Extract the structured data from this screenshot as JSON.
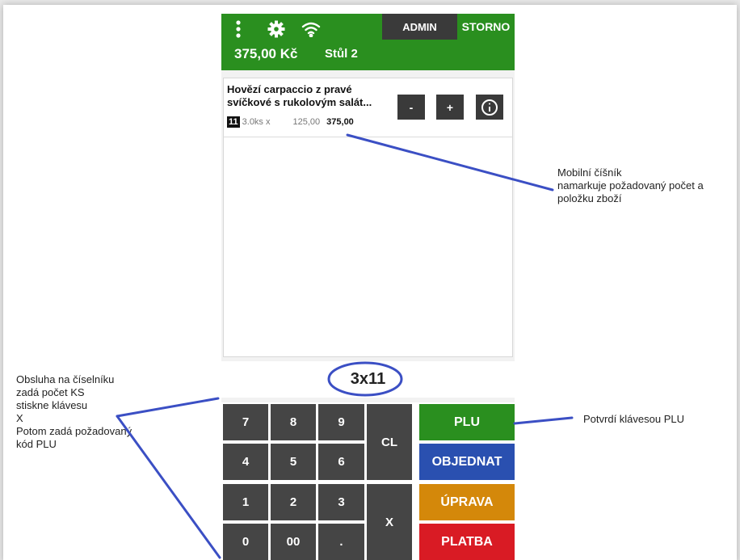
{
  "header": {
    "admin_label": "ADMIN",
    "storno_label": "STORNO",
    "total": "375,00 Kč",
    "table": "Stůl 2",
    "icons": [
      "more-vert-icon",
      "gear-icon",
      "wifi-icon"
    ]
  },
  "order": {
    "items": [
      {
        "name": "Hovězí carpaccio z pravé svíčkové s rukolovým salát...",
        "code": "11",
        "quantity": "3.0ks x",
        "unit_price": "125,00",
        "total": "375,00",
        "minus_label": "-",
        "plus_label": "+"
      }
    ]
  },
  "display": {
    "text": "3x11"
  },
  "keypad": {
    "digits": [
      "7",
      "8",
      "9",
      "4",
      "5",
      "6",
      "1",
      "2",
      "3",
      "0",
      "00",
      "."
    ],
    "clear_label": "CL",
    "multiply_label": "X",
    "plu_label": "PLU",
    "objednat_label": "OBJEDNAT",
    "uprava_label": "ÚPRAVA",
    "platba_label": "PLATBA"
  },
  "annotations": {
    "right_top": [
      "Mobilní číšník",
      "namarkuje požadovaný počet a",
      "položku zboží"
    ],
    "left": [
      "Obsluha na číselníku",
      "zadá počet KS",
      "stiskne klávesu",
      "X",
      "Potom zadá požadovaný",
      "kód PLU"
    ],
    "right_bottom": "Potvrdí klávesou PLU"
  },
  "colors": {
    "header_green": "#2a8f1f",
    "key_dark": "#454545",
    "plu_green": "#2a8f1f",
    "objednat_blue": "#2a50b0",
    "uprava_orange": "#d4880a",
    "platba_red": "#d91b24",
    "annotation_line": "#3b4fc4"
  }
}
